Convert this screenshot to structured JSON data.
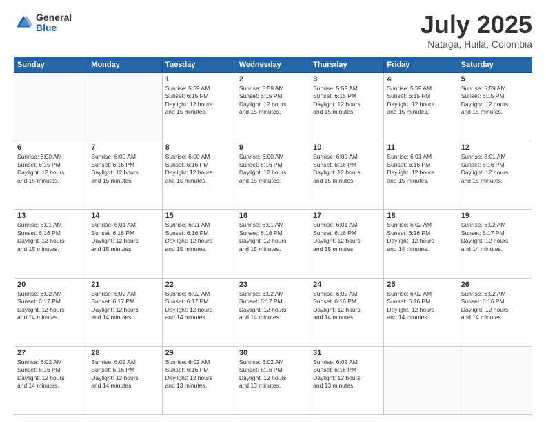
{
  "logo": {
    "general": "General",
    "blue": "Blue"
  },
  "title": "July 2025",
  "location": "Nataga, Huila, Colombia",
  "days_of_week": [
    "Sunday",
    "Monday",
    "Tuesday",
    "Wednesday",
    "Thursday",
    "Friday",
    "Saturday"
  ],
  "weeks": [
    [
      {
        "day": "",
        "info": ""
      },
      {
        "day": "",
        "info": ""
      },
      {
        "day": "1",
        "info": "Sunrise: 5:59 AM\nSunset: 6:15 PM\nDaylight: 12 hours\nand 15 minutes."
      },
      {
        "day": "2",
        "info": "Sunrise: 5:59 AM\nSunset: 6:15 PM\nDaylight: 12 hours\nand 15 minutes."
      },
      {
        "day": "3",
        "info": "Sunrise: 5:59 AM\nSunset: 6:15 PM\nDaylight: 12 hours\nand 15 minutes."
      },
      {
        "day": "4",
        "info": "Sunrise: 5:59 AM\nSunset: 6:15 PM\nDaylight: 12 hours\nand 15 minutes."
      },
      {
        "day": "5",
        "info": "Sunrise: 5:59 AM\nSunset: 6:15 PM\nDaylight: 12 hours\nand 15 minutes."
      }
    ],
    [
      {
        "day": "6",
        "info": "Sunrise: 6:00 AM\nSunset: 6:15 PM\nDaylight: 12 hours\nand 15 minutes."
      },
      {
        "day": "7",
        "info": "Sunrise: 6:00 AM\nSunset: 6:16 PM\nDaylight: 12 hours\nand 15 minutes."
      },
      {
        "day": "8",
        "info": "Sunrise: 6:00 AM\nSunset: 6:16 PM\nDaylight: 12 hours\nand 15 minutes."
      },
      {
        "day": "9",
        "info": "Sunrise: 6:00 AM\nSunset: 6:16 PM\nDaylight: 12 hours\nand 15 minutes."
      },
      {
        "day": "10",
        "info": "Sunrise: 6:00 AM\nSunset: 6:16 PM\nDaylight: 12 hours\nand 15 minutes."
      },
      {
        "day": "11",
        "info": "Sunrise: 6:01 AM\nSunset: 6:16 PM\nDaylight: 12 hours\nand 15 minutes."
      },
      {
        "day": "12",
        "info": "Sunrise: 6:01 AM\nSunset: 6:16 PM\nDaylight: 12 hours\nand 15 minutes."
      }
    ],
    [
      {
        "day": "13",
        "info": "Sunrise: 6:01 AM\nSunset: 6:16 PM\nDaylight: 12 hours\nand 15 minutes."
      },
      {
        "day": "14",
        "info": "Sunrise: 6:01 AM\nSunset: 6:16 PM\nDaylight: 12 hours\nand 15 minutes."
      },
      {
        "day": "15",
        "info": "Sunrise: 6:01 AM\nSunset: 6:16 PM\nDaylight: 12 hours\nand 15 minutes."
      },
      {
        "day": "16",
        "info": "Sunrise: 6:01 AM\nSunset: 6:16 PM\nDaylight: 12 hours\nand 15 minutes."
      },
      {
        "day": "17",
        "info": "Sunrise: 6:01 AM\nSunset: 6:16 PM\nDaylight: 12 hours\nand 15 minutes."
      },
      {
        "day": "18",
        "info": "Sunrise: 6:02 AM\nSunset: 6:16 PM\nDaylight: 12 hours\nand 14 minutes."
      },
      {
        "day": "19",
        "info": "Sunrise: 6:02 AM\nSunset: 6:17 PM\nDaylight: 12 hours\nand 14 minutes."
      }
    ],
    [
      {
        "day": "20",
        "info": "Sunrise: 6:02 AM\nSunset: 6:17 PM\nDaylight: 12 hours\nand 14 minutes."
      },
      {
        "day": "21",
        "info": "Sunrise: 6:02 AM\nSunset: 6:17 PM\nDaylight: 12 hours\nand 14 minutes."
      },
      {
        "day": "22",
        "info": "Sunrise: 6:02 AM\nSunset: 6:17 PM\nDaylight: 12 hours\nand 14 minutes."
      },
      {
        "day": "23",
        "info": "Sunrise: 6:02 AM\nSunset: 6:17 PM\nDaylight: 12 hours\nand 14 minutes."
      },
      {
        "day": "24",
        "info": "Sunrise: 6:02 AM\nSunset: 6:16 PM\nDaylight: 12 hours\nand 14 minutes."
      },
      {
        "day": "25",
        "info": "Sunrise: 6:02 AM\nSunset: 6:16 PM\nDaylight: 12 hours\nand 14 minutes."
      },
      {
        "day": "26",
        "info": "Sunrise: 6:02 AM\nSunset: 6:16 PM\nDaylight: 12 hours\nand 14 minutes."
      }
    ],
    [
      {
        "day": "27",
        "info": "Sunrise: 6:02 AM\nSunset: 6:16 PM\nDaylight: 12 hours\nand 14 minutes."
      },
      {
        "day": "28",
        "info": "Sunrise: 6:02 AM\nSunset: 6:16 PM\nDaylight: 12 hours\nand 14 minutes."
      },
      {
        "day": "29",
        "info": "Sunrise: 6:02 AM\nSunset: 6:16 PM\nDaylight: 12 hours\nand 13 minutes."
      },
      {
        "day": "30",
        "info": "Sunrise: 6:02 AM\nSunset: 6:16 PM\nDaylight: 12 hours\nand 13 minutes."
      },
      {
        "day": "31",
        "info": "Sunrise: 6:02 AM\nSunset: 6:16 PM\nDaylight: 12 hours\nand 13 minutes."
      },
      {
        "day": "",
        "info": ""
      },
      {
        "day": "",
        "info": ""
      }
    ]
  ]
}
